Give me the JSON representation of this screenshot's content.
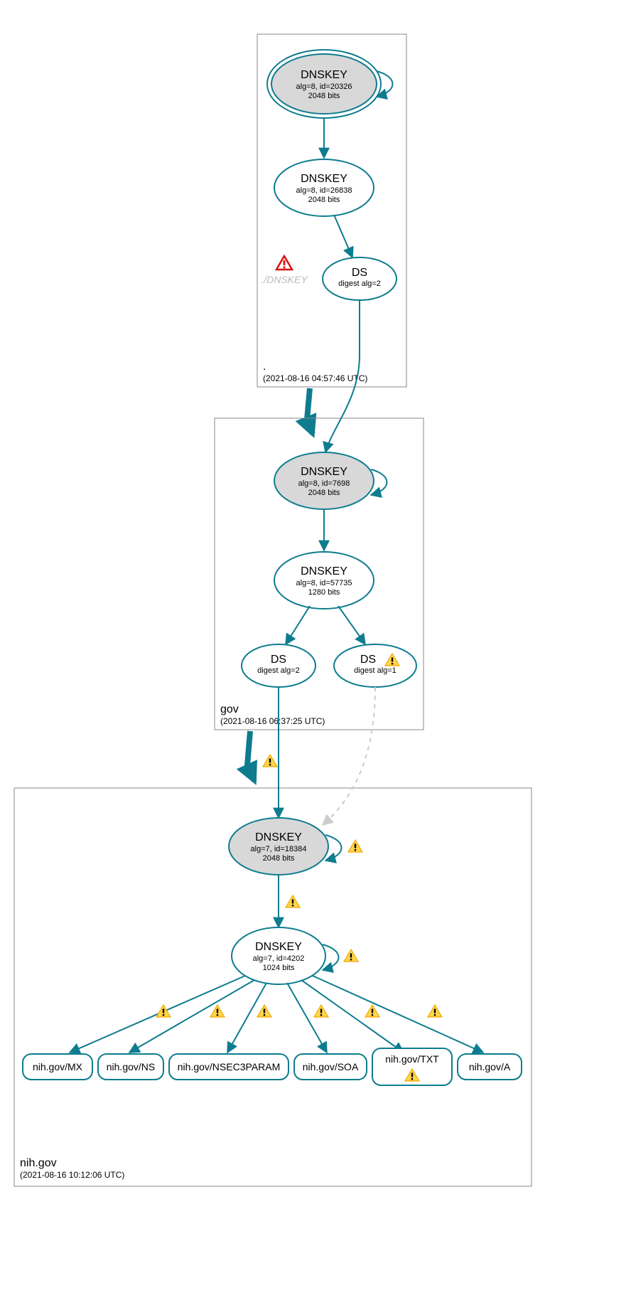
{
  "zones": {
    "root": {
      "name": ".",
      "timestamp": "(2021-08-16 04:57:46 UTC)"
    },
    "gov": {
      "name": "gov",
      "timestamp": "(2021-08-16 06:37:25 UTC)"
    },
    "nih": {
      "name": "nih.gov",
      "timestamp": "(2021-08-16 10:12:06 UTC)"
    }
  },
  "nodes": {
    "root_ksk": {
      "title": "DNSKEY",
      "l1": "alg=8, id=20326",
      "l2": "2048 bits"
    },
    "root_zsk": {
      "title": "DNSKEY",
      "l1": "alg=8, id=26838",
      "l2": "2048 bits"
    },
    "root_ds": {
      "title": "DS",
      "l1": "digest alg=2"
    },
    "root_ghost": {
      "label": "./DNSKEY"
    },
    "gov_ksk": {
      "title": "DNSKEY",
      "l1": "alg=8, id=7698",
      "l2": "2048 bits"
    },
    "gov_zsk": {
      "title": "DNSKEY",
      "l1": "alg=8, id=57735",
      "l2": "1280 bits"
    },
    "gov_ds1": {
      "title": "DS",
      "l1": "digest alg=2"
    },
    "gov_ds2": {
      "title": "DS",
      "l1": "digest alg=1"
    },
    "nih_ksk": {
      "title": "DNSKEY",
      "l1": "alg=7, id=18384",
      "l2": "2048 bits"
    },
    "nih_zsk": {
      "title": "DNSKEY",
      "l1": "alg=7, id=4202",
      "l2": "1024 bits"
    }
  },
  "rrsets": {
    "mx": "nih.gov/MX",
    "ns": "nih.gov/NS",
    "n3p": "nih.gov/NSEC3PARAM",
    "soa": "nih.gov/SOA",
    "txt": "nih.gov/TXT",
    "a": "nih.gov/A"
  }
}
